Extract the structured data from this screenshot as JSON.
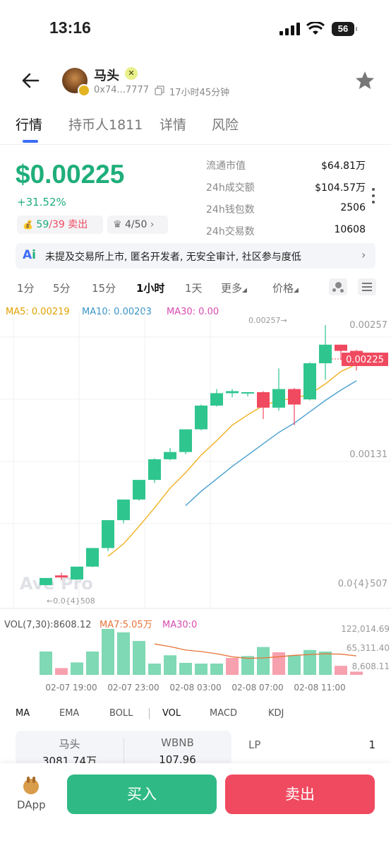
{
  "status_bar": {
    "time": "13:16",
    "battery": "56"
  },
  "header": {
    "token_name": "马头",
    "address": "0x74...7777",
    "age": "17小时45分钟",
    "back_icon": "arrow-left-icon",
    "star_icon": "star-icon"
  },
  "tabs": [
    {
      "label": "行情",
      "active": true
    },
    {
      "label": "持币人1811",
      "active": false
    },
    {
      "label": "详情",
      "active": false
    },
    {
      "label": "风险",
      "active": false
    }
  ],
  "price": {
    "value": "$0.00225",
    "change": "+31.52%",
    "buy_sell": {
      "buy": "59",
      "sep": "/",
      "sell": "39",
      "label": "卖出"
    },
    "rank": "4/50"
  },
  "stats": [
    {
      "label": "流通市值",
      "value": "$64.81万"
    },
    {
      "label": "24h成交额",
      "value": "$104.57万"
    },
    {
      "label": "24h钱包数",
      "value": "2506"
    },
    {
      "label": "24h交易数",
      "value": "10608"
    }
  ],
  "ai_banner": {
    "icon": "ai-icon",
    "text": "未提及交易所上市, 匿名开发者, 无安全审计, 社区参与度低"
  },
  "intervals": [
    {
      "label": "1分",
      "active": false
    },
    {
      "label": "5分",
      "active": false
    },
    {
      "label": "15分",
      "active": false
    },
    {
      "label": "1小时",
      "active": true
    },
    {
      "label": "1天",
      "active": false
    },
    {
      "label": "更多",
      "active": false
    },
    {
      "label": "价格",
      "active": false
    }
  ],
  "ma_legend": {
    "ma5": "MA5: 0.00219",
    "ma10": "MA10: 0.00203",
    "ma30": "MA30: 0.00"
  },
  "colors": {
    "up": "#2fc58f",
    "down": "#f04a60",
    "ma5": "#f0b020",
    "ma10": "#4aa0cf",
    "ma30": "#d84ab0",
    "accent": "#3b6cf6"
  },
  "chart_data": {
    "type": "candlestick",
    "price_axis_ticks": [
      "0.00257",
      "0.00131",
      "0.0{4}507"
    ],
    "current_price_tag": "0.00225",
    "high_marker": "0.00257→",
    "low_marker": "←0.0{4}508",
    "watermark": "Ave Pro",
    "candles": [
      {
        "o": 5.1e-05,
        "h": 6e-05,
        "l": 5e-05,
        "c": 0.00012
      },
      {
        "o": 0.000145,
        "h": 0.00017,
        "l": 0.0001,
        "c": 0.000125
      },
      {
        "o": 0.000105,
        "h": 0.00015,
        "l": 0.0001,
        "c": 0.00023
      },
      {
        "o": 0.00023,
        "h": 0.00028,
        "l": 0.000225,
        "c": 0.00041
      },
      {
        "o": 0.00041,
        "h": 0.00068,
        "l": 0.00038,
        "c": 0.00068
      },
      {
        "o": 0.00068,
        "h": 0.00085,
        "l": 0.00065,
        "c": 0.00088
      },
      {
        "o": 0.00088,
        "h": 0.00107,
        "l": 0.00087,
        "c": 0.00107
      },
      {
        "o": 0.00107,
        "h": 0.00128,
        "l": 0.00104,
        "c": 0.00127
      },
      {
        "o": 0.00127,
        "h": 0.00138,
        "l": 0.00126,
        "c": 0.00134
      },
      {
        "o": 0.00134,
        "h": 0.00155,
        "l": 0.00132,
        "c": 0.00156
      },
      {
        "o": 0.00156,
        "h": 0.0018,
        "l": 0.00155,
        "c": 0.00179
      },
      {
        "o": 0.00179,
        "h": 0.00195,
        "l": 0.00178,
        "c": 0.00191
      },
      {
        "o": 0.00191,
        "h": 0.00195,
        "l": 0.00187,
        "c": 0.00193
      },
      {
        "o": 0.00191,
        "h": 0.00192,
        "l": 0.00188,
        "c": 0.00192
      },
      {
        "o": 0.00192,
        "h": 0.00193,
        "l": 0.00166,
        "c": 0.00177
      },
      {
        "o": 0.00177,
        "h": 0.00215,
        "l": 0.00174,
        "c": 0.00195
      },
      {
        "o": 0.00195,
        "h": 0.00196,
        "l": 0.0016,
        "c": 0.0018
      },
      {
        "o": 0.00185,
        "h": 0.00221,
        "l": 0.00184,
        "c": 0.0022
      },
      {
        "o": 0.0022,
        "h": 0.00257,
        "l": 0.00204,
        "c": 0.00238
      },
      {
        "o": 0.00238,
        "h": 0.00238,
        "l": 0.00223,
        "c": 0.00232
      },
      {
        "o": 0.00232,
        "h": 0.00233,
        "l": 0.00213,
        "c": 0.00225
      }
    ],
    "ma5": [
      null,
      null,
      null,
      null,
      0.00033,
      0.00045,
      0.00062,
      0.0008,
      0.00099,
      0.00114,
      0.00131,
      0.00145,
      0.0016,
      0.0017,
      0.00179,
      0.00184,
      0.00186,
      0.0019,
      0.002,
      0.00212,
      0.00219
    ],
    "ma10": [
      null,
      null,
      null,
      null,
      null,
      null,
      null,
      null,
      null,
      0.00082,
      0.00096,
      0.00108,
      0.0012,
      0.00131,
      0.00142,
      0.00153,
      0.00162,
      0.00173,
      0.00184,
      0.00194,
      0.00203
    ],
    "volume": {
      "legend": {
        "vol": "VOL(7,30):8608.12",
        "ma7": "MA7:5.05万",
        "ma30": "MA30:0"
      },
      "axis_ticks": [
        "122,014.69",
        "65,311.40",
        "8,608.11"
      ],
      "x_labels": [
        "02-07 19:00",
        "02-07 23:00",
        "02-08 03:00",
        "02-08 07:00",
        "02-08 11:00"
      ],
      "bars": [
        {
          "v": 62000,
          "up": true
        },
        {
          "v": 18000,
          "up": false
        },
        {
          "v": 33000,
          "up": true
        },
        {
          "v": 62000,
          "up": true
        },
        {
          "v": 122000,
          "up": true
        },
        {
          "v": 113000,
          "up": true
        },
        {
          "v": 90000,
          "up": true
        },
        {
          "v": 30000,
          "up": true
        },
        {
          "v": 52000,
          "up": true
        },
        {
          "v": 32000,
          "up": true
        },
        {
          "v": 30000,
          "up": true
        },
        {
          "v": 30000,
          "up": true
        },
        {
          "v": 45000,
          "up": false
        },
        {
          "v": 50000,
          "up": true
        },
        {
          "v": 74000,
          "up": true
        },
        {
          "v": 60000,
          "up": false
        },
        {
          "v": 52000,
          "up": true
        },
        {
          "v": 66000,
          "up": true
        },
        {
          "v": 62000,
          "up": true
        },
        {
          "v": 24000,
          "up": false
        },
        {
          "v": 8608,
          "up": false
        }
      ],
      "ma7": [
        null,
        null,
        null,
        null,
        null,
        null,
        null,
        82000,
        75000,
        66000,
        62000,
        56000,
        48000,
        44000,
        45000,
        48000,
        52000,
        54000,
        56000,
        55000,
        50500
      ]
    }
  },
  "indicator_tabs": [
    {
      "label": "MA",
      "active": true
    },
    {
      "label": "EMA",
      "active": false
    },
    {
      "label": "BOLL",
      "active": false
    },
    {
      "label": "VOL",
      "active": true
    },
    {
      "label": "MACD",
      "active": false
    },
    {
      "label": "KDJ",
      "active": false
    }
  ],
  "pool": {
    "token_a": "马头",
    "amount_a": "3081.74万",
    "token_b": "WBNB",
    "amount_b": "107.96",
    "lp_label": "LP",
    "lp_value": "1"
  },
  "bottom_bar": {
    "dapp_label": "DApp",
    "buy_label": "买入",
    "sell_label": "卖出"
  }
}
